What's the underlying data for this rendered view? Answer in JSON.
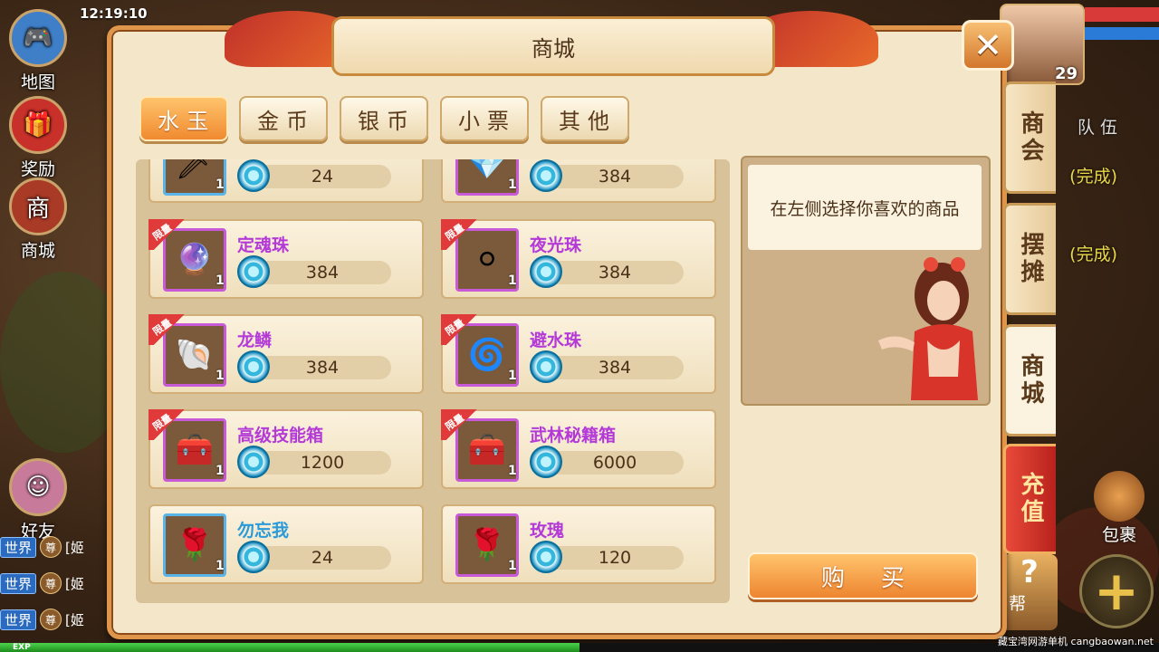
{
  "hud": {
    "time": "12:19:10",
    "exp_label": "EXP",
    "level": "29"
  },
  "left_menu": [
    {
      "label": "地图",
      "icon": "gamepad-icon"
    },
    {
      "label": "奖励",
      "icon": "reward-bag-icon"
    },
    {
      "label": "商城",
      "icon": "shop-gate-icon"
    },
    {
      "label": "好友",
      "icon": "friend-avatar-icon"
    }
  ],
  "chat": [
    {
      "channel": "世界",
      "rank": "尊",
      "text": "[姬"
    },
    {
      "channel": "世界",
      "rank": "尊",
      "text": "[姬"
    },
    {
      "channel": "世界",
      "rank": "尊",
      "text": "[姬"
    }
  ],
  "right_hud": {
    "team_label": "队伍",
    "status1": "(完成)",
    "status2": "(完成)",
    "bag_label": "包裹",
    "help_label": "帮"
  },
  "dialog": {
    "title": "商城",
    "tabs": [
      "水玉",
      "金币",
      "银币",
      "小票",
      "其他"
    ],
    "active_tab": 0,
    "limit_badge": "限量",
    "items": [
      {
        "name": "",
        "qty": "1",
        "price": "24",
        "limited": false,
        "frame": "blue",
        "glyph": "🗡"
      },
      {
        "name": "",
        "qty": "1",
        "price": "384",
        "limited": false,
        "frame": "purple",
        "glyph": "💎"
      },
      {
        "name": "定魂珠",
        "qty": "1",
        "price": "384",
        "limited": true,
        "frame": "purple",
        "glyph": "🔮"
      },
      {
        "name": "夜光珠",
        "qty": "1",
        "price": "384",
        "limited": true,
        "frame": "purple",
        "glyph": "⚪"
      },
      {
        "name": "龙鳞",
        "qty": "1",
        "price": "384",
        "limited": true,
        "frame": "purple",
        "glyph": "🐚"
      },
      {
        "name": "避水珠",
        "qty": "1",
        "price": "384",
        "limited": true,
        "frame": "purple",
        "glyph": "🌀"
      },
      {
        "name": "高级技能箱",
        "qty": "1",
        "price": "1200",
        "limited": true,
        "frame": "purple",
        "glyph": "🧰"
      },
      {
        "name": "武林秘籍箱",
        "qty": "1",
        "price": "6000",
        "limited": true,
        "frame": "purple",
        "glyph": "🧰"
      },
      {
        "name": "勿忘我",
        "qty": "1",
        "price": "24",
        "limited": false,
        "frame": "blue",
        "glyph": "🌹"
      },
      {
        "name": "玫瑰",
        "qty": "1",
        "price": "120",
        "limited": false,
        "frame": "purple",
        "glyph": "🌹"
      }
    ],
    "info_text": "在左侧选择你喜欢的商品",
    "buy_label": "购买",
    "side_tabs": [
      {
        "label": "商会",
        "style": "normal"
      },
      {
        "label": "摆摊",
        "style": "normal"
      },
      {
        "label": "商城",
        "style": "active"
      },
      {
        "label": "充值",
        "style": "red"
      }
    ]
  },
  "colors": {
    "accent": "#f08a30",
    "item_name": "#b43ad8",
    "item_name_blue": "#2a9ad8",
    "limit_badge": "#e03a3a"
  },
  "watermark": "藏宝湾网游单机 cangbaowan.net"
}
